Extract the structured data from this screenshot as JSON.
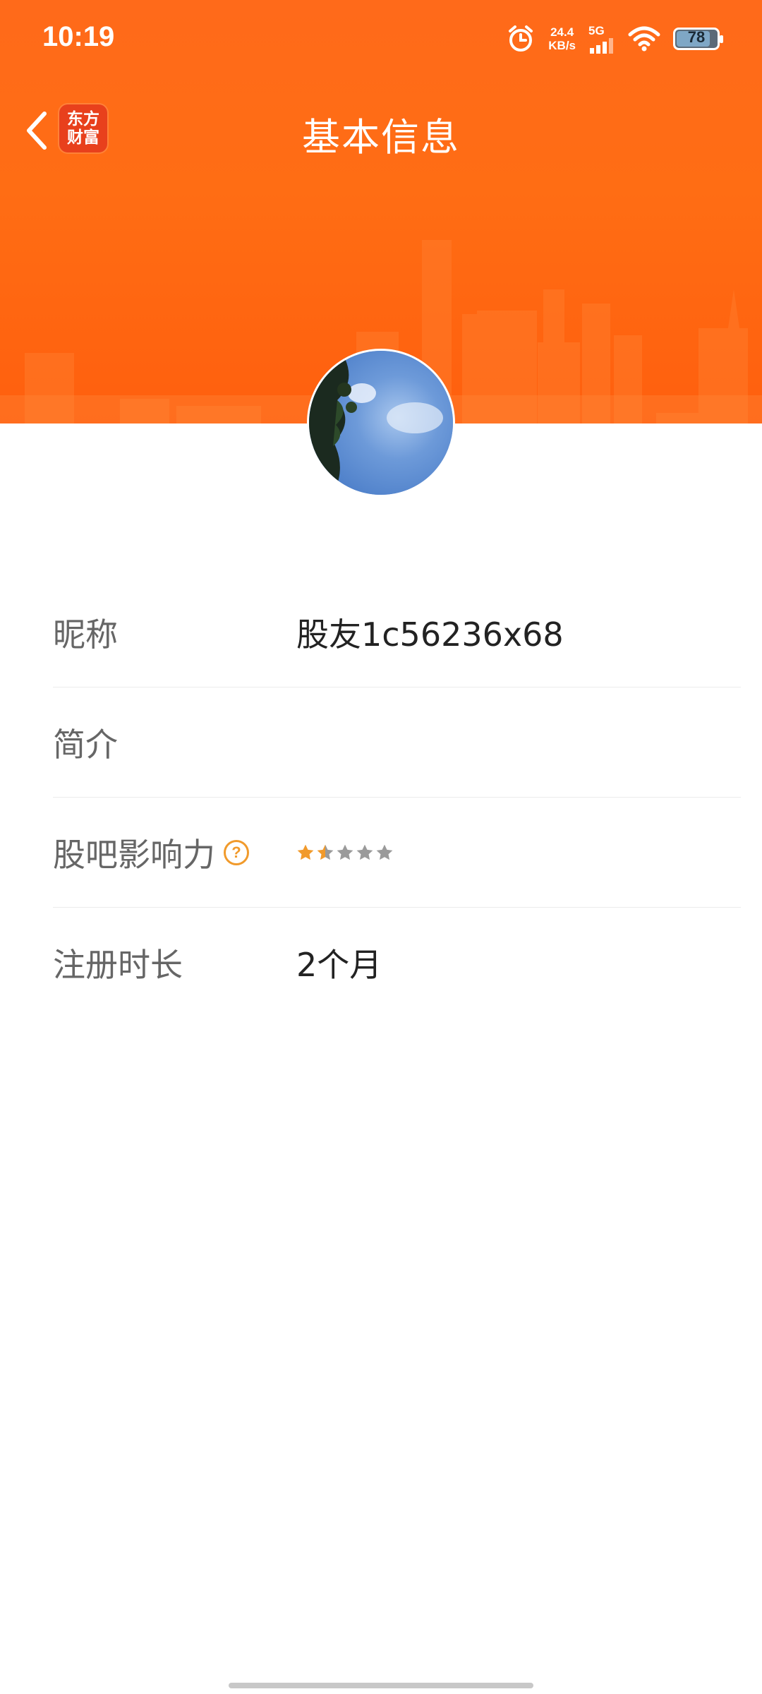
{
  "status_bar": {
    "time": "10:19",
    "net_speed_value": "24.4",
    "net_speed_unit": "KB/s",
    "network_type": "5G",
    "battery_level": "78"
  },
  "header": {
    "title": "基本信息",
    "logo_line1": "东方",
    "logo_line2": "财富"
  },
  "profile": {
    "fields": [
      {
        "label": "昵称",
        "value": "股友1c56236x68"
      },
      {
        "label": "简介",
        "value": ""
      },
      {
        "label": "股吧影响力",
        "help_icon": "question-circle-icon",
        "rating": 1.5,
        "rating_max": 5
      },
      {
        "label": "注册时长",
        "value": "2个月"
      }
    ]
  },
  "colors": {
    "header_orange": "#ff6a1a",
    "star_active": "#f19a2b",
    "star_inactive": "#9a9a9a"
  }
}
